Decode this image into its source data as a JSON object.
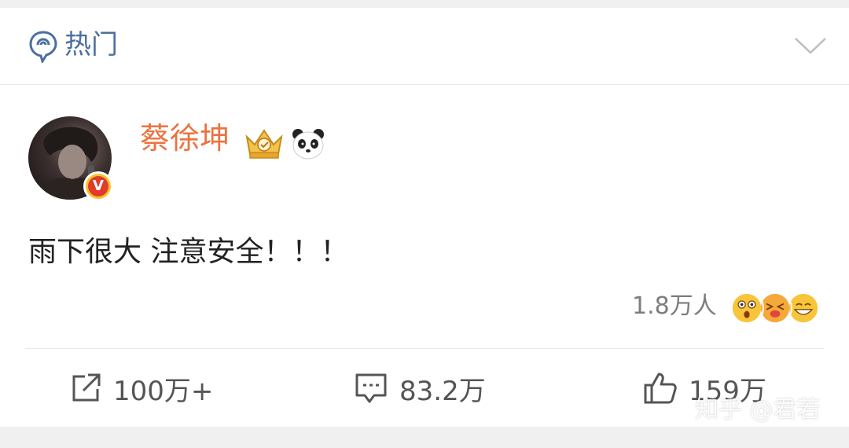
{
  "header": {
    "section_label": "热门"
  },
  "post": {
    "username": "蔡徐坤",
    "text": "雨下很大 注意安全！！！",
    "reaction_count": "1.8万人",
    "verified_badge_letter": "V"
  },
  "actions": {
    "share_count": "100万+",
    "comment_count": "83.2万",
    "like_count": "159万"
  },
  "watermark": "知乎 @君若",
  "colors": {
    "username": "#eb7340",
    "section_label": "#4a6fa1"
  }
}
